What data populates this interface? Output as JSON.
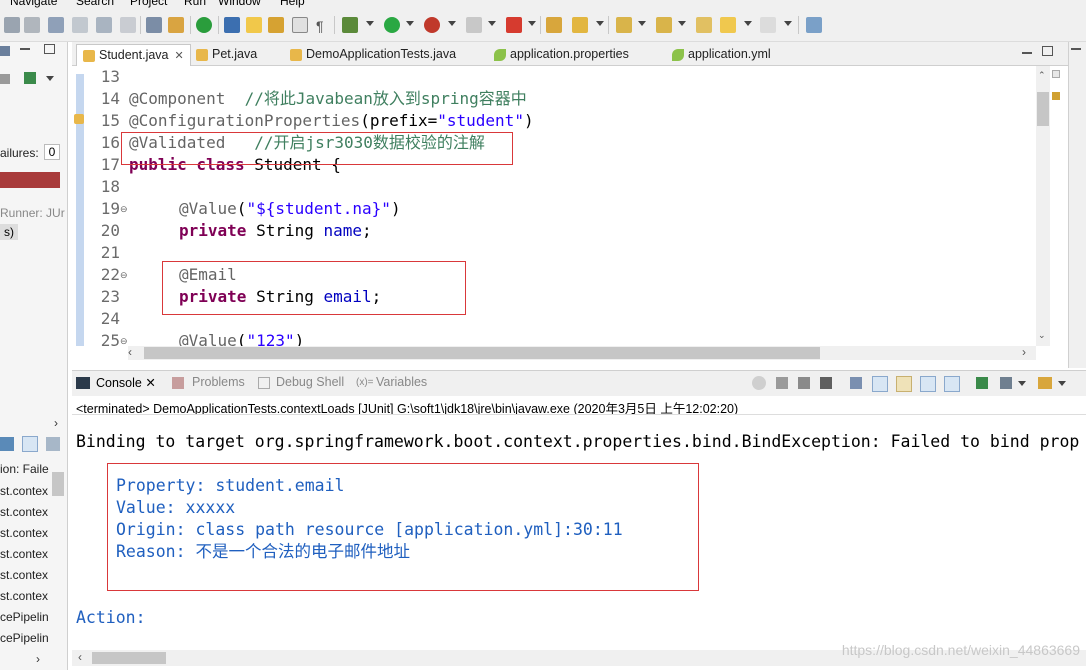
{
  "menu": [
    "Navigate",
    "Search",
    "Project",
    "Run",
    "Window",
    "Help"
  ],
  "left_panel": {
    "failures_label": "ailures:",
    "failures_value": "0",
    "runner_label": "Runner: JUr",
    "chip_label": "s)",
    "tree_items": [
      "ion: Faile",
      "st.contex",
      "st.contex",
      "st.contex",
      "st.contex",
      "st.contex",
      "st.contex",
      "cePipelin",
      "cePipelin"
    ]
  },
  "editor_tabs": [
    {
      "label": "Student.java",
      "close": "✕"
    },
    {
      "label": "Pet.java"
    },
    {
      "label": "DemoApplicationTests.java"
    },
    {
      "label": "application.properties"
    },
    {
      "label": "application.yml"
    }
  ],
  "code_lines": [
    {
      "n": "13"
    },
    {
      "n": "14",
      "text": "@Component  //将此Javabean放入到spring容器中"
    },
    {
      "n": "15",
      "text": "@ConfigurationProperties(prefix=\"student\")"
    },
    {
      "n": "16",
      "text": "@Validated   //开启jsr3030数据校验的注解"
    },
    {
      "n": "17",
      "text": "public class Student {"
    },
    {
      "n": "18"
    },
    {
      "n": "19",
      "text": "@Value(\"${student.na}\")"
    },
    {
      "n": "20",
      "text": "private String name;"
    },
    {
      "n": "21"
    },
    {
      "n": "22",
      "text": "@Email"
    },
    {
      "n": "23",
      "text": "private String email;"
    },
    {
      "n": "24"
    },
    {
      "n": "25",
      "text": "@Value(\"123\")"
    }
  ],
  "console_tabs": [
    {
      "label": "Console",
      "close": "✕"
    },
    {
      "label": "Problems"
    },
    {
      "label": "Debug Shell"
    },
    {
      "label": "Variables",
      "prefix": "(x)="
    }
  ],
  "terminated_line": "<terminated> DemoApplicationTests.contextLoads [JUnit] G:\\soft1\\jdk18\\jre\\bin\\javaw.exe (2020年3月5日 上午12:02:20)",
  "console_output": {
    "line1": "Binding to target org.springframework.boot.context.properties.bind.BindException: Failed to bind prop",
    "property": "Property: student.email",
    "value": "Value: xxxxx",
    "origin": "Origin: class path resource [application.yml]:30:11",
    "reason": "Reason: 不是一个合法的电子邮件地址",
    "action": "Action:"
  },
  "watermark": "https://blog.csdn.net/weixin_44863669",
  "colors": {
    "annotation": "#646464",
    "keyword": "#7f0055",
    "comment": "#3f7f5f",
    "string": "#2a00ff",
    "field": "#0000c0",
    "console_blue": "#1f5fbf",
    "highlight_box": "#d9383a"
  }
}
